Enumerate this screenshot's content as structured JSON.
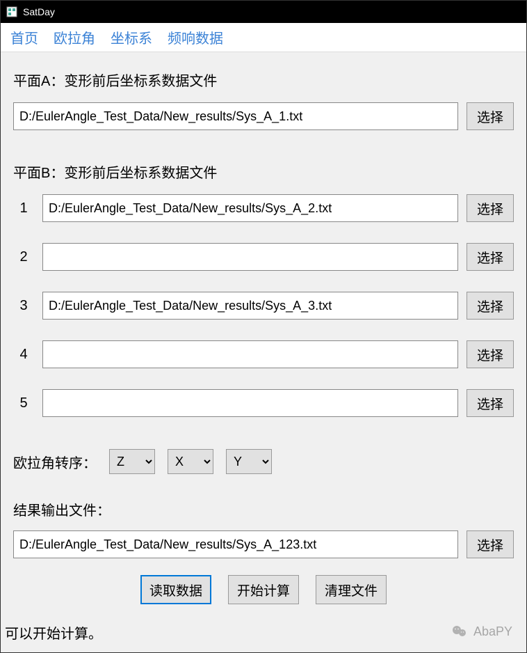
{
  "window": {
    "title": "SatDay"
  },
  "menu": {
    "items": [
      "首页",
      "欧拉角",
      "坐标系",
      "频响数据"
    ]
  },
  "planeA": {
    "label": "平面A：变形前后坐标系数据文件",
    "value": "D:/EulerAngle_Test_Data/New_results/Sys_A_1.txt",
    "select_btn": "选择"
  },
  "planeB": {
    "label": "平面B：变形前后坐标系数据文件",
    "rows": [
      {
        "num": "1",
        "value": "D:/EulerAngle_Test_Data/New_results/Sys_A_2.txt"
      },
      {
        "num": "2",
        "value": ""
      },
      {
        "num": "3",
        "value": "D:/EulerAngle_Test_Data/New_results/Sys_A_3.txt"
      },
      {
        "num": "4",
        "value": ""
      },
      {
        "num": "5",
        "value": ""
      }
    ],
    "select_btn": "选择"
  },
  "euler": {
    "label": "欧拉角转序：",
    "axes": [
      "Z",
      "X",
      "Y"
    ]
  },
  "output": {
    "label": "结果输出文件：",
    "value": "D:/EulerAngle_Test_Data/New_results/Sys_A_123.txt",
    "select_btn": "选择"
  },
  "actions": {
    "read": "读取数据",
    "start": "开始计算",
    "clear": "清理文件"
  },
  "status": "可以开始计算。",
  "watermark": "AbaPY"
}
